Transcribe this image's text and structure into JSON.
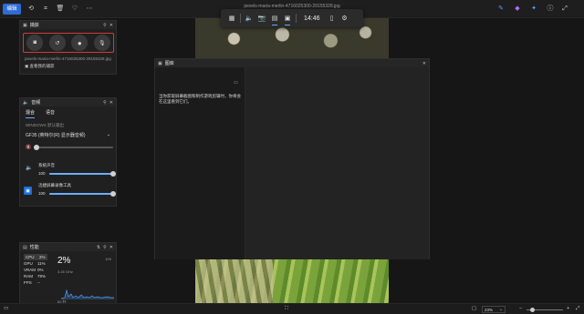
{
  "viewer": {
    "file_title": "pexels-maria-merlin-4716025300-29155328.jpg",
    "edit_label": "编辑",
    "zoom_value": "23%"
  },
  "gamebar": {
    "time": "14:46"
  },
  "capture": {
    "title": "捕获",
    "last_file": "pexels-maria-merlin-4716025300-29155328.jpg",
    "view_link": "查看我的捕获"
  },
  "audio": {
    "title": "音频",
    "tab_mix": "混合",
    "tab_voice": "语音",
    "default_output_label": "WINDOWS 默认输出",
    "device": "GF35 (英特尔(R) 显示器音频)",
    "device_volume": 0.02,
    "apps": [
      {
        "name": "系统声音",
        "value": "100",
        "volume": 1.0
      },
      {
        "name": "迅捷屏幕录像工具",
        "value": "100",
        "volume": 1.0
      }
    ]
  },
  "gallery": {
    "title": "图库",
    "message": "当你获取屏幕截图和制作游戏剪辑时，你将会在这里看到它们。"
  },
  "performance": {
    "title": "性能",
    "stats": [
      {
        "key": "CPU",
        "value": "2%"
      },
      {
        "key": "GPU",
        "value": "11%"
      },
      {
        "key": "VRAM",
        "value": "0%"
      },
      {
        "key": "RAM",
        "value": "79%"
      },
      {
        "key": "FPS",
        "value": "--"
      }
    ],
    "big_value": "2%",
    "sub": "3.26 GHz",
    "max": "100",
    "min": "60 秒"
  }
}
